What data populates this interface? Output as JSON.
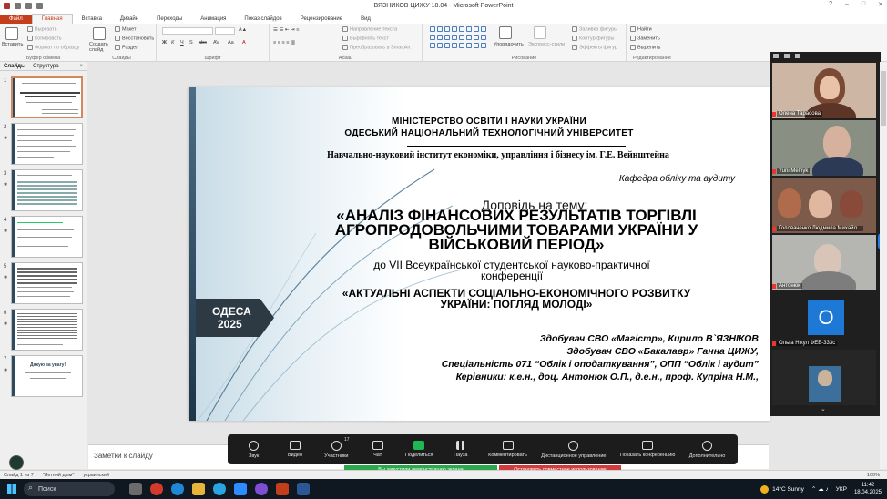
{
  "window": {
    "title": "ВЯЗНИКОВ ЦИЖУ 18.04 - Microsoft PowerPoint",
    "controls": [
      "?",
      "–",
      "□",
      "✕"
    ]
  },
  "ribbon_tabs": [
    "Файл",
    "Главная",
    "Вставка",
    "Дизайн",
    "Переходы",
    "Анимация",
    "Показ слайдов",
    "Рецензирование",
    "Вид"
  ],
  "ribbon": {
    "clipboard": {
      "paste": "Вставить",
      "cut": "Вырезать",
      "copy": "Копировать",
      "format_painter": "Формат по образцу",
      "label": "Буфер обмена"
    },
    "slides": {
      "new_slide": "Создать слайд",
      "layout": "Макет",
      "reset": "Восстановить",
      "section": "Раздел",
      "label": "Слайды"
    },
    "font": {
      "label": "Шрифт",
      "bold": "Ж",
      "italic": "К",
      "underline": "Ч",
      "shadow": "S",
      "strike": "abc",
      "spacing": "AV",
      "case": "Aa",
      "color": "A"
    },
    "paragraph": {
      "text_direction": "Направление текста",
      "align_text": "Выровнять текст",
      "smartart": "Преобразовать в SmartArt",
      "label": "Абзац"
    },
    "drawing": {
      "arrange": "Упорядочить",
      "quick_styles": "Экспресс-стили",
      "fill": "Заливка фигуры",
      "outline": "Контур фигуры",
      "effects": "Эффекты фигур",
      "label": "Рисование"
    },
    "editing": {
      "find": "Найти",
      "replace": "Заменить",
      "select": "Выделить",
      "label": "Редактирование"
    }
  },
  "left_pane": {
    "tab_slides": "Слайды",
    "tab_outline": "Структура",
    "close": "×",
    "thumbnails": [
      "1",
      "2",
      "3",
      "4",
      "5",
      "6",
      "7"
    ],
    "thumb7_text": "Дякую за увагу!"
  },
  "slide": {
    "ministry": "МІНІСТЕРСТВО  ОСВІТИ І НАУКИ УКРАЇНИ",
    "university": "ОДЕСЬКИЙ  НАЦІОНАЛЬНИЙ  ТЕХНОЛОГІЧНИЙ  УНІВЕРСИТЕТ",
    "institute": "Навчально-науковий інститут  економіки, управління  і бізнесу  ім.  Г.Е. Вейнштейна",
    "department": "Кафедра обліку та аудиту",
    "report_on": "Доповідь на тему:",
    "topic": "«АНАЛІЗ ФІНАНСОВИХ РЕЗУЛЬТАТІВ ТОРГІВЛІ АГРОПРОДОВОЛЬЧИМИ ТОВАРАМИ УКРАЇНИ У ВІЙСЬКОВИЙ ПЕРІОД»",
    "conference": "до VII Всеукраїнської студентської науково-практичної конференції",
    "conference_title": "«АКТУАЛЬНІ  АСПЕКТИ  СОЦІАЛЬНО-ЕКОНОМІЧНОГО  РОЗВИТКУ УКРАЇНИ: ПОГЛЯД МОЛОДІ»",
    "city": "ОДЕСА",
    "year": "2025",
    "author1": "Здобувач  СВО «Магістр»,  Кирило В`ЯЗНІКОВ",
    "author2": "Здобувач  СВО «Бакалавр» Ганна ЦИЖУ,",
    "specialty": "Спеціальність 071 “Облік і оподаткування”,  ОПП “Облік і аудит”",
    "supervisors": "Керівники: к.е.н., доц. Антонюк О.П., д.е.н., проф. Купріна Н.М.,"
  },
  "notes": {
    "placeholder": "Заметки к слайду"
  },
  "participants": [
    {
      "name": "Олена Тарасова"
    },
    {
      "name": "Yurii Melnyk"
    },
    {
      "name": "Головаченко Людмила Михайл..."
    },
    {
      "name": "Антонюк"
    },
    {
      "name": "Ольга Нікул ФЕБ-333с",
      "initial": "О"
    },
    {
      "name": ""
    }
  ],
  "meeting_toolbar": {
    "items": [
      "Звук",
      "Видео",
      "Участники",
      "Чат",
      "Поделиться",
      "Пауза",
      "Комментировать",
      "Дистанционное управление",
      "Показать конференцию",
      "Дополнительно"
    ],
    "participants_count": "17"
  },
  "banners": {
    "sharing": "Вы запустили демонстрацию экрана",
    "stop": "Остановить совместное использование"
  },
  "status_bar": {
    "slide_info": "Слайд 1 из 7",
    "theme": "\"Летний дым\"",
    "language": "украинский",
    "zoom": "100%"
  },
  "taskbar": {
    "search": "Поиск",
    "weather": "14°C  Sunny",
    "lang": "УКР",
    "time": "11:42",
    "date": "18.04.2025"
  },
  "colors": {
    "accent": "#c43e1c",
    "slide_dark": "#2d3a44",
    "zoom_bar": "#1c1c1c",
    "share_green": "#2aa84a",
    "stop_red": "#d23b3b",
    "avatar_blue": "#1e78d6"
  }
}
